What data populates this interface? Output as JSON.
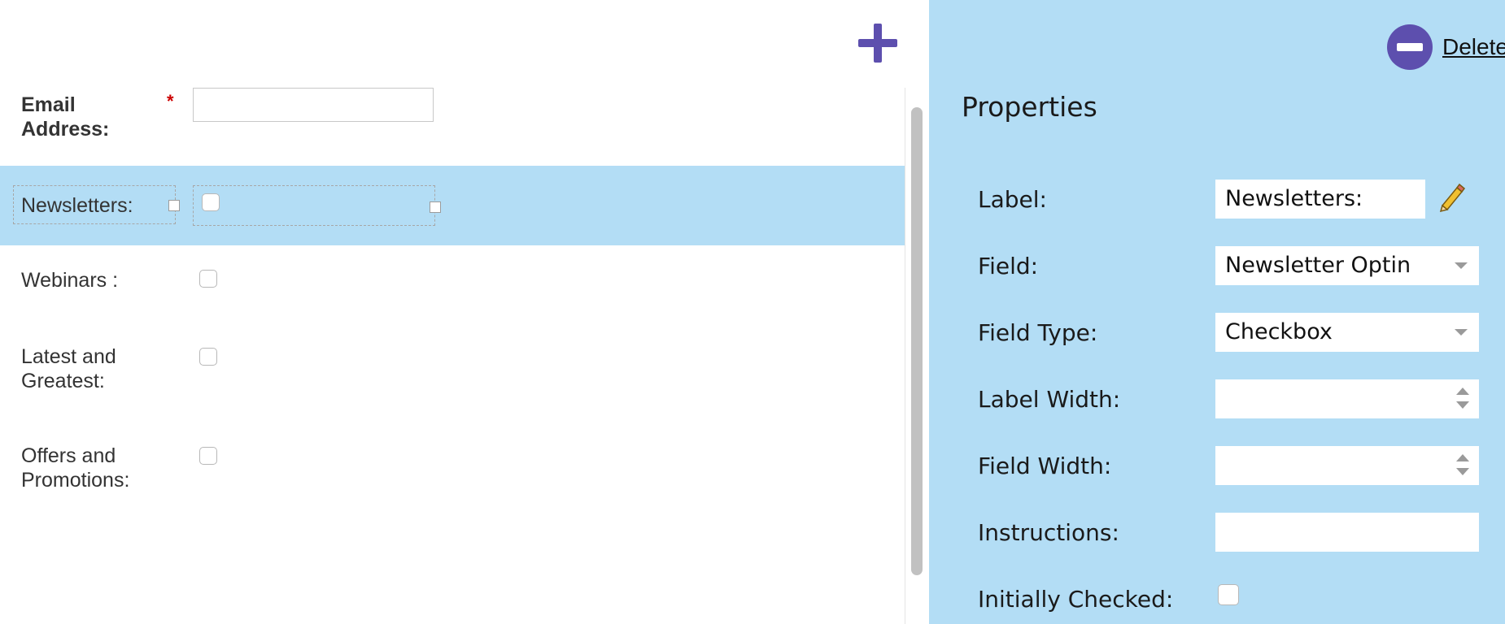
{
  "canvas": {
    "add_icon": "plus-icon",
    "fields": [
      {
        "label": "Email Address:",
        "required_mark": "*"
      },
      {
        "label": "Newsletters:"
      },
      {
        "label": "Webinars :"
      },
      {
        "label": "Latest and Greatest:"
      },
      {
        "label": "Offers and Promotions:"
      }
    ]
  },
  "panel": {
    "delete_icon": "minus-circle-icon",
    "delete_label": "Delete",
    "title": "Properties",
    "props": {
      "label": {
        "name": "Label:",
        "value": "Newsletters:"
      },
      "field": {
        "name": "Field:",
        "value": "Newsletter Optin"
      },
      "field_type": {
        "name": "Field Type:",
        "value": "Checkbox"
      },
      "label_width": {
        "name": "Label Width:",
        "value": ""
      },
      "field_width": {
        "name": "Field Width:",
        "value": ""
      },
      "instructions": {
        "name": "Instructions:",
        "value": ""
      },
      "initially_checked": {
        "name": "Initially Checked:",
        "checked": false
      }
    },
    "edit_icon": "pencil-icon"
  },
  "colors": {
    "accent": "#5d4fae",
    "selection": "#b3ddf5",
    "required": "#cc0000"
  }
}
